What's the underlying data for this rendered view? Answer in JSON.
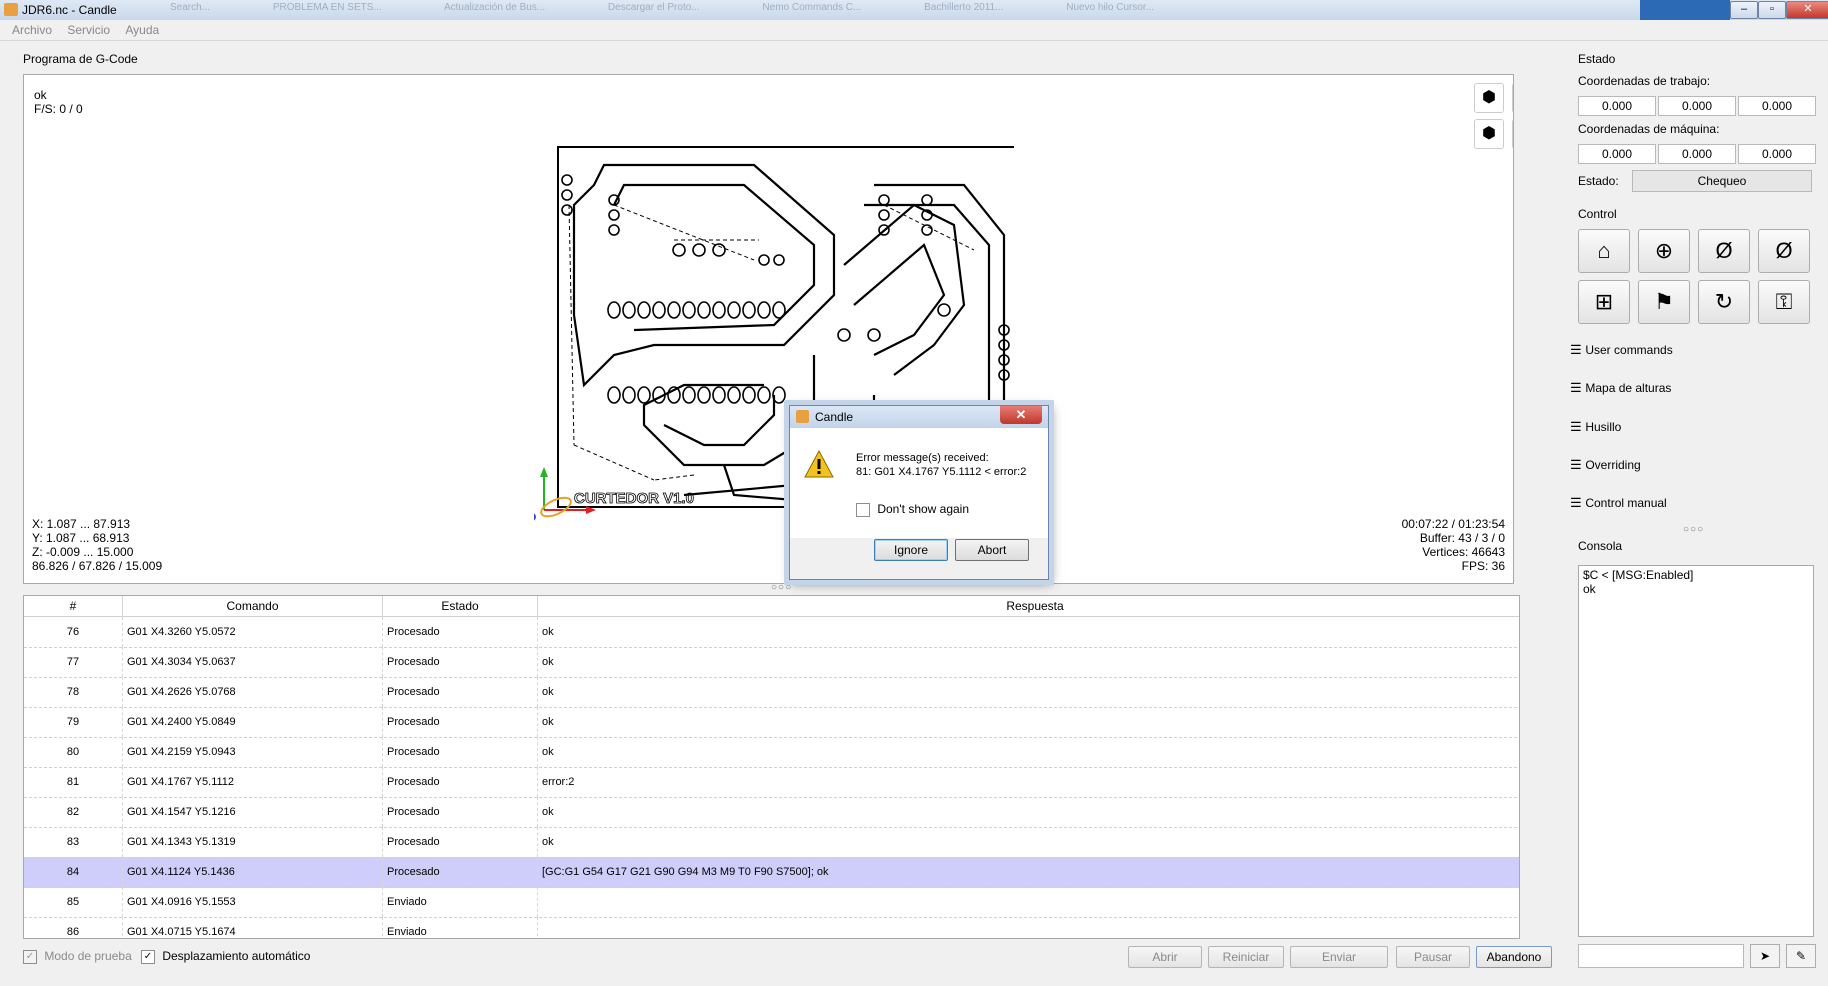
{
  "window": {
    "title": "JDR6.nc - Candle",
    "ghost_tabs": [
      "Search...",
      "PROBLEMA EN SETS...",
      "Actualización de Bus...",
      "Descargar el Proto...",
      "Nemo Commands C...",
      "Bachillerto 2011...",
      "Nuevo hilo Cursor..."
    ]
  },
  "menu": [
    "Archivo",
    "Servicio",
    "Ayuda"
  ],
  "gcode_group": {
    "label": "Programa de G-Code",
    "status_line1": "ok",
    "status_line2": "F/S: 0 / 0",
    "bounds": [
      "X: 1.087 ... 87.913",
      "Y: 1.087 ... 68.913",
      "Z: -0.009 ... 15.000",
      "86.826 / 67.826 / 15.009"
    ],
    "stats": [
      "00:07:22 / 01:23:54",
      "Buffer: 43 / 3 / 0",
      "Vertices: 46643",
      "FPS: 36"
    ],
    "board_label": "CURTEDOR V1.0"
  },
  "table": {
    "headers": [
      "#",
      "Comando",
      "Estado",
      "Respuesta"
    ],
    "rows": [
      {
        "n": "76",
        "cmd": "G01 X4.3260 Y5.0572",
        "state": "Procesado",
        "resp": "ok"
      },
      {
        "n": "77",
        "cmd": "G01 X4.3034 Y5.0637",
        "state": "Procesado",
        "resp": "ok"
      },
      {
        "n": "78",
        "cmd": "G01 X4.2626 Y5.0768",
        "state": "Procesado",
        "resp": "ok"
      },
      {
        "n": "79",
        "cmd": "G01 X4.2400 Y5.0849",
        "state": "Procesado",
        "resp": "ok"
      },
      {
        "n": "80",
        "cmd": "G01 X4.2159 Y5.0943",
        "state": "Procesado",
        "resp": "ok"
      },
      {
        "n": "81",
        "cmd": "G01 X4.1767 Y5.1112",
        "state": "Procesado",
        "resp": "error:2"
      },
      {
        "n": "82",
        "cmd": "G01 X4.1547 Y5.1216",
        "state": "Procesado",
        "resp": "ok"
      },
      {
        "n": "83",
        "cmd": "G01 X4.1343 Y5.1319",
        "state": "Procesado",
        "resp": "ok"
      },
      {
        "n": "84",
        "cmd": "G01 X4.1124 Y5.1436",
        "state": "Procesado",
        "resp": "[GC:G1 G54 G17 G21 G90 G94 M3 M9 T0 F90 S7500]; ok"
      },
      {
        "n": "85",
        "cmd": "G01 X4.0916 Y5.1553",
        "state": "Enviado",
        "resp": ""
      },
      {
        "n": "86",
        "cmd": "G01 X4.0715 Y5.1674",
        "state": "Enviado",
        "resp": ""
      }
    ]
  },
  "bottom": {
    "test_mode": "Modo de prueba",
    "autoscroll": "Desplazamiento automático",
    "buttons": [
      "Abrir",
      "Reiniciar",
      "Enviar",
      "Pausar",
      "Abandono"
    ]
  },
  "state_panel": {
    "label": "Estado",
    "work_label": "Coordenadas de trabajo:",
    "work": [
      "0.000",
      "0.000",
      "0.000"
    ],
    "machine_label": "Coordenadas de máquina:",
    "machine": [
      "0.000",
      "0.000",
      "0.000"
    ],
    "status_label": "Estado:",
    "status_value": "Chequeo"
  },
  "control": {
    "label": "Control"
  },
  "sections": [
    "User commands",
    "Mapa de alturas",
    "Husillo",
    "Overriding",
    "Control manual"
  ],
  "console": {
    "label": "Consola",
    "text": "$C < [MSG:Enabled]\nok"
  },
  "dialog": {
    "title": "Candle",
    "line1": "Error message(s) received:",
    "line2": "81: G01 X4.1767 Y5.1112 < error:2",
    "checkbox": "Don't show again",
    "ignore": "Ignore",
    "abort": "Abort"
  }
}
